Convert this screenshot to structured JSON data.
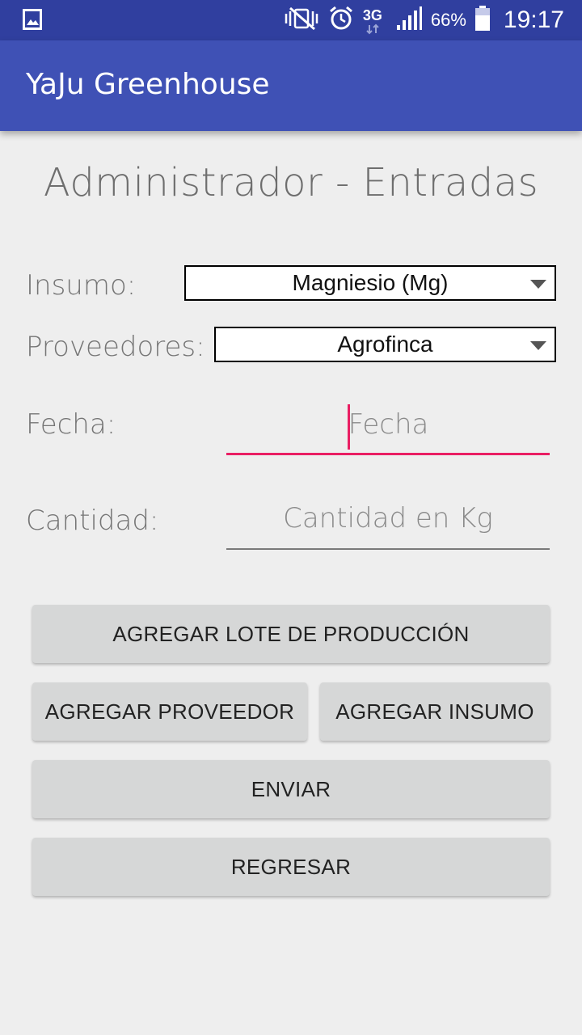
{
  "status_bar": {
    "battery_percent": "66%",
    "time": "19:17",
    "network": "3G",
    "icons": [
      "gallery-icon",
      "vibrate-mute-icon",
      "alarm-icon",
      "network-3g-icon",
      "signal-icon",
      "battery-icon"
    ]
  },
  "app_bar": {
    "title": "YaJu Greenhouse"
  },
  "page": {
    "title": "Administrador - Entradas"
  },
  "form": {
    "insumo_label": "Insumo:",
    "insumo_value": "Magniesio (Mg)",
    "proveedores_label": "Proveedores:",
    "proveedores_value": "Agrofinca",
    "fecha_label": "Fecha:",
    "fecha_placeholder": "Fecha",
    "cantidad_label": "Cantidad:",
    "cantidad_placeholder": "Cantidad en Kg"
  },
  "buttons": {
    "agregar_lote": "AGREGAR LOTE DE PRODUCCIÓN",
    "agregar_proveedor": "AGREGAR PROVEEDOR",
    "agregar_insumo": "AGREGAR INSUMO",
    "enviar": "ENVIAR",
    "regresar": "REGRESAR"
  },
  "colors": {
    "status_bar": "#303f9f",
    "app_bar": "#3f51b5",
    "accent": "#e91e63",
    "button": "#d6d7d7",
    "background": "#eeeeee"
  }
}
